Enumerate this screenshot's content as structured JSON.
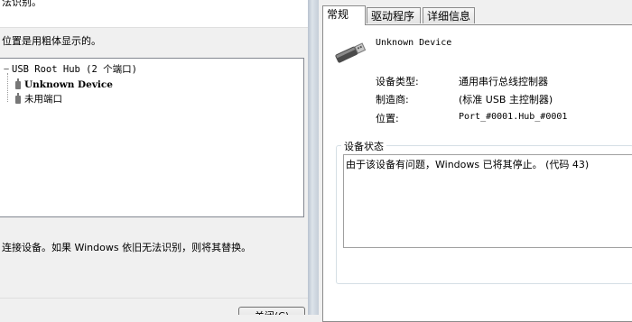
{
  "left": {
    "top_text": "法识别。",
    "bold_hint": "位置是用粗体显示的。",
    "tree": {
      "root": "USB Root Hub (2 个端口)",
      "device": "Unknown Device",
      "unused": "未用端口"
    },
    "replace_hint": "连接设备。如果 Windows 依旧无法识别，则将其替换。",
    "close_button": "关闭(C)"
  },
  "right": {
    "tabs": [
      "常规",
      "驱动程序",
      "详细信息"
    ],
    "device_name": "Unknown Device",
    "props": [
      {
        "label": "设备类型:",
        "value": "通用串行总线控制器"
      },
      {
        "label": "制造商:",
        "value": "(标准 USB 主控制器)"
      },
      {
        "label": "位置:",
        "value": "Port_#0001.Hub_#0001"
      }
    ],
    "status_legend": "设备状态",
    "status_text": "由于该设备有问题，Windows 已将其停止。 (代码 43)"
  },
  "icons": {
    "device": "usb-plug-icon",
    "tree_device": "usb-device-icon"
  },
  "colors": {
    "window_bg": "#f0f0f0",
    "panel_bg": "#ffffff",
    "border": "#8c8c8c"
  }
}
